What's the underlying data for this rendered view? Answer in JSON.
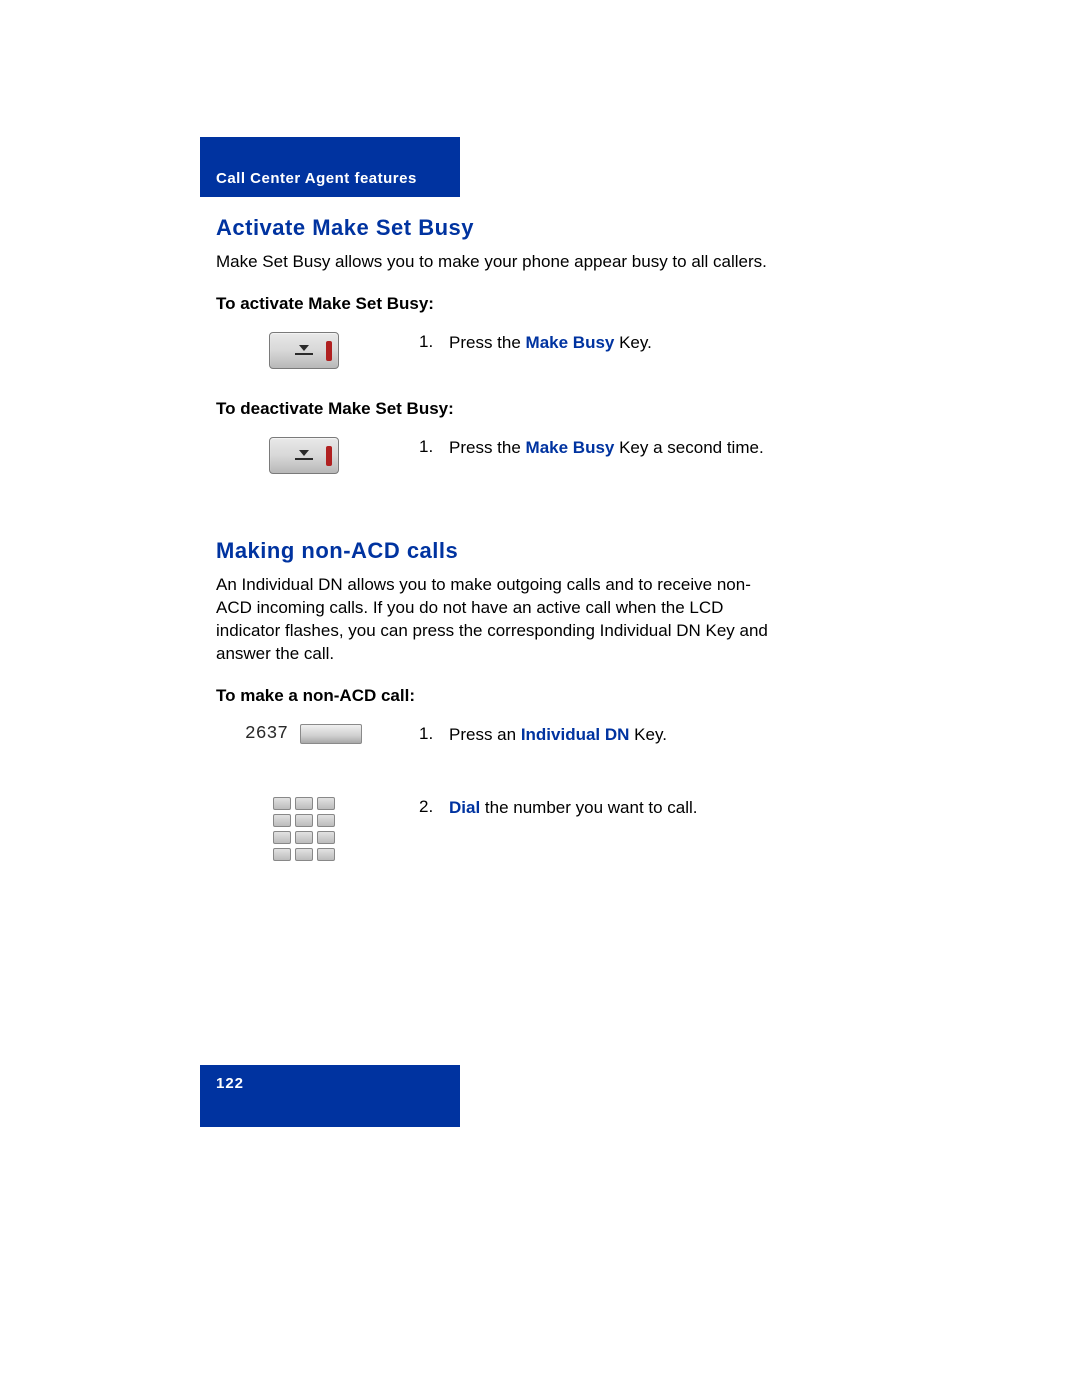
{
  "header": {
    "section_label": "Call Center Agent features"
  },
  "section1": {
    "title": "Activate Make Set Busy",
    "intro": "Make Set Busy allows you to make your phone appear busy to all callers.",
    "activate_heading": "To activate Make Set Busy:",
    "activate_step_num": "1.",
    "activate_step_pre": "Press the ",
    "activate_step_key": "Make Busy",
    "activate_step_post": " Key.",
    "deactivate_heading": "To deactivate Make Set Busy:",
    "deactivate_step_num": "1.",
    "deactivate_step_pre": "Press the ",
    "deactivate_step_key": "Make Busy",
    "deactivate_step_post": " Key a second time."
  },
  "section2": {
    "title": "Making non-ACD calls",
    "intro": "An Individual DN allows you to make outgoing calls and to receive non-ACD incoming calls. If you do not have an active call when the LCD indicator flashes, you can press the corresponding Individual DN Key and answer the call.",
    "make_heading": "To make a non-ACD call:",
    "dn_digits": "2637",
    "step1_num": "1.",
    "step1_pre": "Press an ",
    "step1_key": "Individual DN",
    "step1_post": " Key.",
    "step2_num": "2.",
    "step2_key": "Dial",
    "step2_post": " the number you want to call."
  },
  "footer": {
    "page_number": "122"
  }
}
